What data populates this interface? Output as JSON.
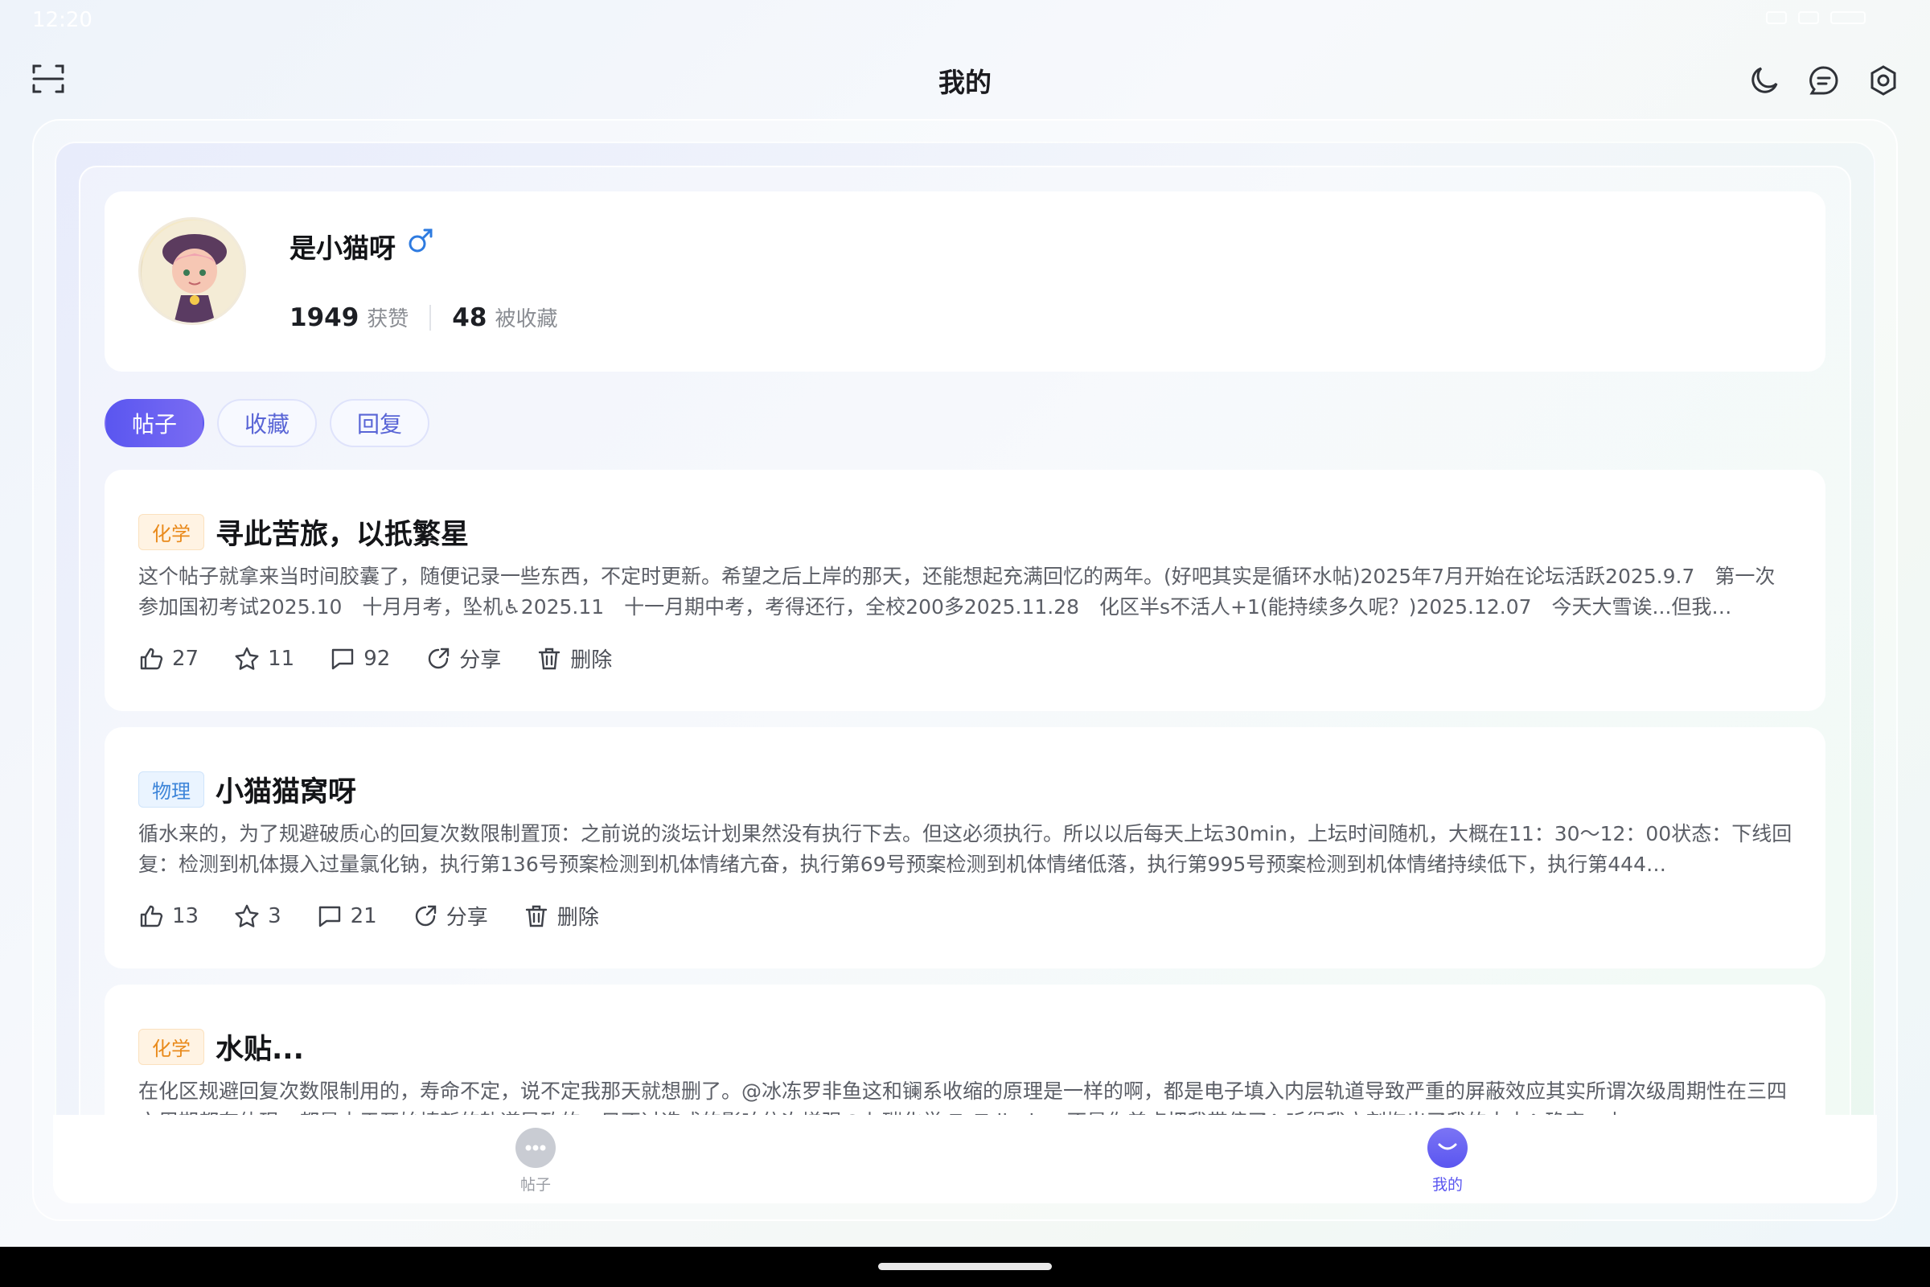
{
  "status_bar": {
    "time": "12:20"
  },
  "header": {
    "title": "我的",
    "icons": [
      "scan-icon",
      "moon-icon",
      "message-icon",
      "settings-icon"
    ]
  },
  "profile": {
    "name": "是小猫呀",
    "gender_icon": "male-icon",
    "likes_count": "1949",
    "likes_label": "获赞",
    "favorites_count": "48",
    "favorites_label": "被收藏"
  },
  "tabs": [
    {
      "label": "帖子",
      "active": true
    },
    {
      "label": "收藏",
      "active": false
    },
    {
      "label": "回复",
      "active": false
    }
  ],
  "posts": [
    {
      "tag": "化学",
      "title": "寻此苦旅，以扺繁星",
      "body": "这个帖子就拿来当时间胶囊了，随便记录一些东西，不定时更新。希望之后上岸的那天，还能想起充满回忆的两年。(好吧其实是循环水帖)2025年7月开始在论坛活跃2025.9.7　第一次参加国初考试2025.10　十月月考，坠机♿2025.11　十一月期中考，考得还行，全校200多2025.11.28　化区半s不活人+1(能持续多久呢？)2025.12.07　今天大雪诶...但我…",
      "likes": "27",
      "stars": "11",
      "comments": "92",
      "share_label": "分享",
      "delete_label": "删除"
    },
    {
      "tag": "物理",
      "title": "小猫猫窝呀",
      "body": "循水来的，为了规避破质心的回复次数限制置顶：之前说的淡坛计划果然没有执行下去。但这必须执行。所以以后每天上坛30min，上坛时间随机，大概在11：30〜12：00状态：下线回复：检测到机体摄入过量氯化钠，执行第136号预案检测到机体情绪亢奋，执行第69号预案检测到机体情绪低落，执行第995号预案检测到机体情绪持续低下，执行第444…",
      "likes": "13",
      "stars": "3",
      "comments": "21",
      "share_label": "分享",
      "delete_label": "删除"
    },
    {
      "tag": "化学",
      "title": "水贴...",
      "body": "在化区规避回复次数限制用的，寿命不定，说不定我那天就想删了。@冰冻罗非鱼这和镧系收缩的原理是一样的啊，都是电子填入内层轨道导致严重的屏蔽效应其实所谓次级周期性在三四六周期都有体现，都是由于开始填新的轨道导致的，只不过造成的影响依次增强@七碳化学 ZnTellurium不是你差点把我带偏了♿听得我立刻掏出了我的大本♿确实，上…"
    }
  ],
  "bottom_nav": [
    {
      "label": "帖子",
      "icon": "chat-bubble-icon",
      "active": false
    },
    {
      "label": "我的",
      "icon": "profile-smile-icon",
      "active": true
    }
  ],
  "colors": {
    "accent": "#5a56f0",
    "chem_tag": "#e98a1b",
    "phys_tag": "#3d85d9"
  }
}
